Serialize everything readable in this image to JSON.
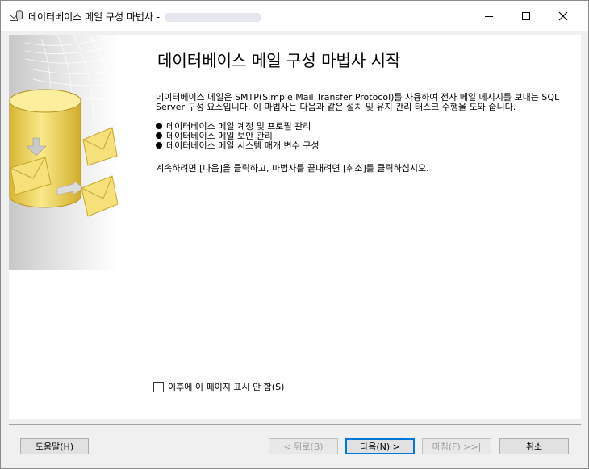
{
  "window": {
    "title": "데이터베이스 메일 구성 마법사 -"
  },
  "page": {
    "heading": "데이터베이스 메일 구성 마법사 시작",
    "intro": "데이터베이스 메일은 SMTP(Simple Mail Transfer Protocol)를 사용하여 전자 메일 메시지를 보내는 SQL Server 구성 요소입니다. 이 마법사는 다음과 같은 설치 및 유지 관리 태스크 수행을 도와 줍니다.",
    "tasks": [
      "데이터베이스 메일 계정 및 프로필 관리",
      "데이터베이스 메일 보안 관리",
      "데이터베이스 메일 시스템 매개 변수 구성"
    ],
    "instruction": "계속하려면 [다음]을 클릭하고, 마법사를 끝내려면 [취소]를 클릭하십시오.",
    "skip_checkbox_label": "이후에 이 페이지 표시 안 함(S)",
    "skip_checked": false
  },
  "buttons": {
    "help": "도움말(H)",
    "back": "< 뒤로(B)",
    "next": "다음(N) >",
    "finish": "마침(F) >>|",
    "cancel": "취소"
  },
  "colors": {
    "accent": "#0078d7",
    "cylinder": "#f2d65a",
    "envelope": "#f6e07a"
  }
}
